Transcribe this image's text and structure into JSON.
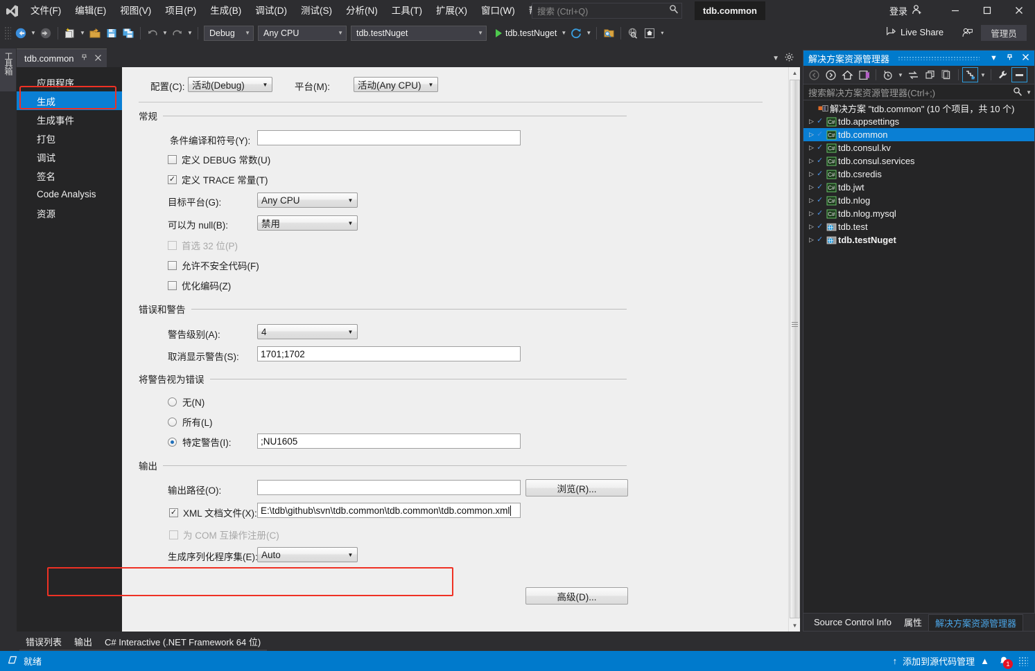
{
  "titlebar": {
    "app_icon": "visual-studio-logo",
    "menu": [
      "文件(F)",
      "编辑(E)",
      "视图(V)",
      "项目(P)",
      "生成(B)",
      "调试(D)",
      "测试(S)",
      "分析(N)",
      "工具(T)",
      "扩展(X)",
      "窗口(W)",
      "帮助(H)"
    ],
    "search_placeholder": "搜索 (Ctrl+Q)",
    "document_chip": "tdb.common",
    "signin_label": "登录",
    "window_minimize": "–",
    "window_maximize": "□",
    "window_close": "✕"
  },
  "toolbar": {
    "config_value": "Debug",
    "platform_value": "Any CPU",
    "startup_value": "tdb.testNuget",
    "run_label": "tdb.testNuget",
    "live_share_label": "Live Share",
    "admin_label": "管理员"
  },
  "toolbox_tab": "工具箱",
  "document_tab": {
    "title": "tdb.common",
    "pin_icon": "pin-icon",
    "close_icon": "close-icon"
  },
  "properties_nav": {
    "items": [
      {
        "label": "应用程序",
        "selected": false
      },
      {
        "label": "生成",
        "selected": true
      },
      {
        "label": "生成事件",
        "selected": false
      },
      {
        "label": "打包",
        "selected": false
      },
      {
        "label": "调试",
        "selected": false
      },
      {
        "label": "签名",
        "selected": false
      },
      {
        "label": "Code Analysis",
        "selected": false
      },
      {
        "label": "资源",
        "selected": false
      }
    ]
  },
  "build_page": {
    "config_label": "配置(C):",
    "config_value": "活动(Debug)",
    "platform_label": "平台(M):",
    "platform_value": "活动(Any CPU)",
    "group_general": "常规",
    "cond_symbols_label": "条件编译和符号(Y):",
    "cond_symbols_value": "",
    "define_debug_label": "定义 DEBUG 常数(U)",
    "define_debug_checked": false,
    "define_trace_label": "定义 TRACE 常量(T)",
    "define_trace_checked": true,
    "target_platform_label": "目标平台(G):",
    "target_platform_value": "Any CPU",
    "nullable_label": "可以为 null(B):",
    "nullable_value": "禁用",
    "prefer32_label": "首选 32 位(P)",
    "prefer32_checked": false,
    "prefer32_disabled": true,
    "unsafe_label": "允许不安全代码(F)",
    "unsafe_checked": false,
    "optimize_label": "优化编码(Z)",
    "optimize_checked": false,
    "group_errors": "错误和警告",
    "warn_level_label": "警告级别(A):",
    "warn_level_value": "4",
    "suppress_warn_label": "取消显示警告(S):",
    "suppress_warn_value": "1701;1702",
    "group_warn_as_error": "将警告视为错误",
    "radio_none": "无(N)",
    "radio_all": "所有(L)",
    "radio_specific": "特定警告(I):",
    "radio_selected": "specific",
    "specific_warn_value": ";NU1605",
    "group_output": "输出",
    "output_path_label": "输出路径(O):",
    "output_path_value": "",
    "browse_button": "浏览(R)...",
    "xml_doc_label": "XML 文档文件(X):",
    "xml_doc_checked": true,
    "xml_doc_value": "E:\\tdb\\github\\svn\\tdb.common\\tdb.common\\tdb.common.xml",
    "com_interop_label": "为 COM 互操作注册(C)",
    "com_interop_checked": false,
    "com_interop_disabled": true,
    "serialization_label": "生成序列化程序集(E):",
    "serialization_value": "Auto",
    "advanced_button": "高级(D)..."
  },
  "solution_explorer": {
    "title": "解决方案资源管理器",
    "search_placeholder": "搜索解决方案资源管理器(Ctrl+;)",
    "root_label": "解决方案 \"tdb.common\" (10 个项目，共 10 个)",
    "items": [
      {
        "label": "tdb.appsettings",
        "kind": "csharp",
        "selected": false,
        "bold": false
      },
      {
        "label": "tdb.common",
        "kind": "csharp",
        "selected": true,
        "bold": false
      },
      {
        "label": "tdb.consul.kv",
        "kind": "csharp",
        "selected": false,
        "bold": false
      },
      {
        "label": "tdb.consul.services",
        "kind": "csharp",
        "selected": false,
        "bold": false
      },
      {
        "label": "tdb.csredis",
        "kind": "csharp",
        "selected": false,
        "bold": false
      },
      {
        "label": "tdb.jwt",
        "kind": "csharp",
        "selected": false,
        "bold": false
      },
      {
        "label": "tdb.nlog",
        "kind": "csharp",
        "selected": false,
        "bold": false
      },
      {
        "label": "tdb.nlog.mysql",
        "kind": "csharp",
        "selected": false,
        "bold": false
      },
      {
        "label": "tdb.test",
        "kind": "web",
        "selected": false,
        "bold": false
      },
      {
        "label": "tdb.testNuget",
        "kind": "web",
        "selected": false,
        "bold": true
      }
    ],
    "bottom_tabs": [
      {
        "label": "Source Control Info",
        "active": false
      },
      {
        "label": "属性",
        "active": false
      },
      {
        "label": "解决方案资源管理器",
        "active": true
      }
    ]
  },
  "bottom_tabs": [
    "错误列表",
    "输出",
    "C# Interactive (.NET Framework 64 位)"
  ],
  "status_bar": {
    "ready_label": "就绪",
    "source_control_label": "添加到源代码管理",
    "notification_count": "1"
  },
  "colors": {
    "accent_blue": "#007acc",
    "selection_blue": "#0a7fd4",
    "highlight_red": "#ef3124",
    "dark_chrome": "#2d2d30",
    "darker_panel": "#252526",
    "light_pane": "#efefef"
  }
}
